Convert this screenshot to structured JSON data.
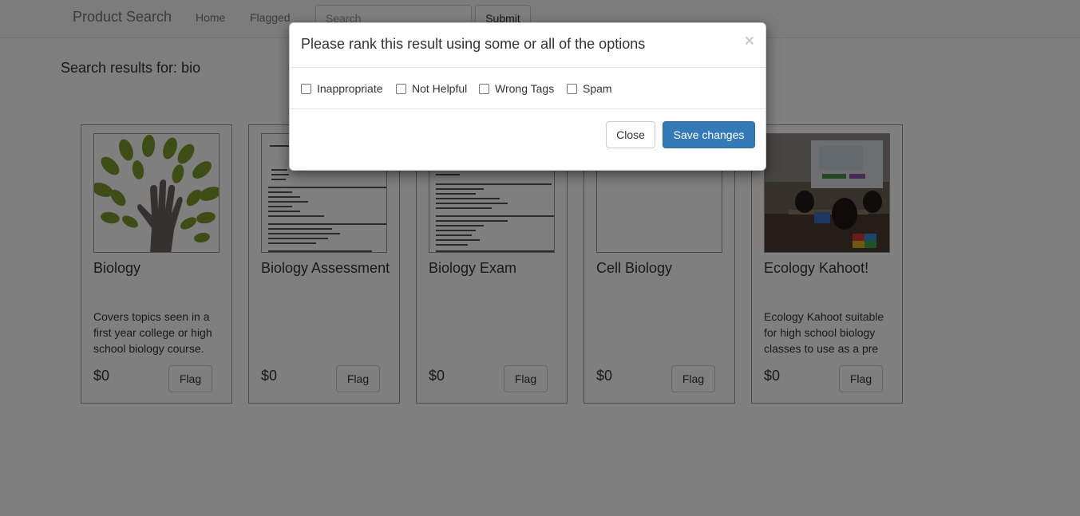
{
  "navbar": {
    "brand": "Product Search",
    "links": [
      "Home",
      "Flagged"
    ],
    "search_placeholder": "Search",
    "submit_label": "Submit"
  },
  "results_heading": "Search results for: bio",
  "cards": [
    {
      "title": "Biology",
      "description": "Covers topics seen in a first year college or high school biology course.",
      "price": "$0",
      "flag_label": "Flag",
      "thumb": "tree-hand-image"
    },
    {
      "title": "Biology Assessment",
      "description": "",
      "price": "$0",
      "flag_label": "Flag",
      "thumb": "document-image"
    },
    {
      "title": "Biology Exam",
      "description": "",
      "price": "$0",
      "flag_label": "Flag",
      "thumb": "document-image"
    },
    {
      "title": "Cell Biology",
      "description": "",
      "price": "$0",
      "flag_label": "Flag",
      "thumb": "blank-image"
    },
    {
      "title": "Ecology Kahoot!",
      "description": "Ecology Kahoot suitable for high school biology classes to use as a pre",
      "price": "$0",
      "flag_label": "Flag",
      "thumb": "classroom-photo"
    }
  ],
  "modal": {
    "title": "Please rank this result using some or all of the options",
    "close_symbol": "×",
    "options": [
      {
        "label": "Inappropriate",
        "checked": false
      },
      {
        "label": "Not Helpful",
        "checked": false
      },
      {
        "label": "Wrong Tags",
        "checked": false
      },
      {
        "label": "Spam",
        "checked": false
      }
    ],
    "close_label": "Close",
    "save_label": "Save changes"
  },
  "colors": {
    "primary": "#337ab7",
    "leaf": "#7a9a2b",
    "hand": "#6b625c"
  }
}
